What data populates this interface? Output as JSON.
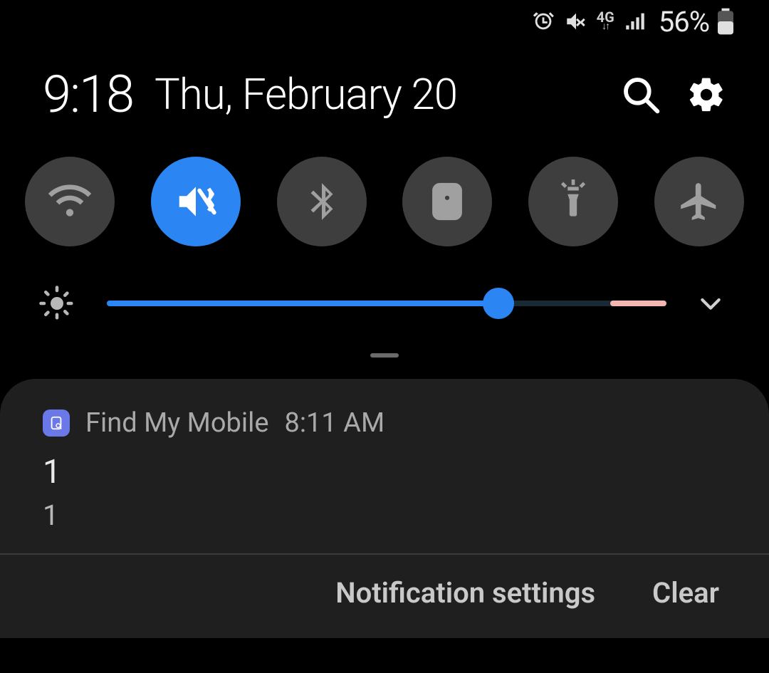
{
  "status": {
    "network_label": "4G",
    "battery_percent": "56%"
  },
  "header": {
    "time": "9:18",
    "date": "Thu, February 20"
  },
  "toggles": {
    "wifi": false,
    "sound_vibrate": true,
    "bluetooth": false,
    "rotation_lock": false,
    "flashlight": false,
    "airplane": false
  },
  "brightness": {
    "value_percent": 70,
    "warn_zone_percent": 10
  },
  "notification": {
    "app_name": "Find My Mobile",
    "time": "8:11 AM",
    "title": "1",
    "body": "1"
  },
  "actions": {
    "settings": "Notification settings",
    "clear": "Clear"
  }
}
